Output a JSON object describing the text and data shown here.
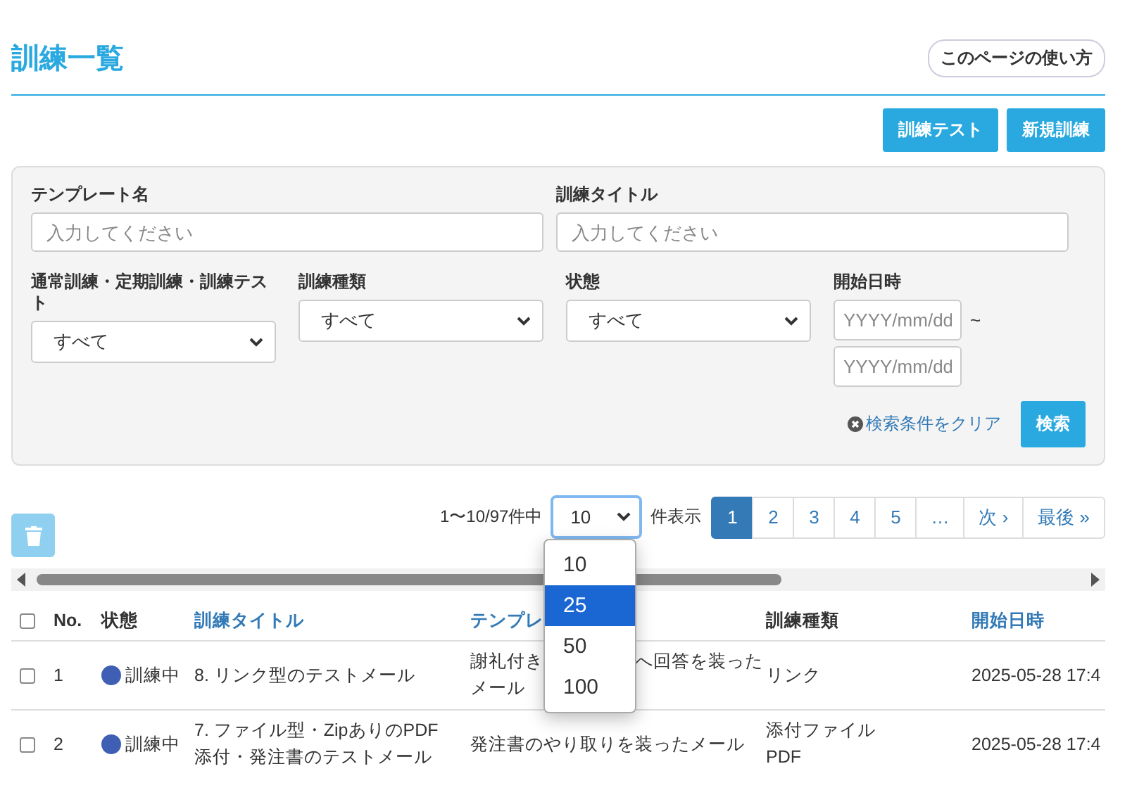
{
  "page": {
    "title": "訓練一覧",
    "help_button": "このページの使い方"
  },
  "actions": [
    "訓練テスト",
    "新規訓練"
  ],
  "filters": {
    "text_fields": [
      {
        "kind": "text",
        "label": "テンプレート名",
        "placeholder": "入力してください"
      },
      {
        "kind": "text",
        "label": "訓練タイトル",
        "placeholder": "入力してください"
      }
    ],
    "option_fields": [
      {
        "kind": "select",
        "label": "通常訓練・定期訓練・訓練テスト",
        "value": "すべて"
      },
      {
        "kind": "select",
        "label": "訓練種類",
        "value": "すべて"
      },
      {
        "kind": "select",
        "label": "状態",
        "value": "すべて"
      },
      {
        "kind": "daterange",
        "label": "開始日時",
        "from_placeholder": "YYYY/mm/dd",
        "to_placeholder": "YYYY/mm/dd",
        "separator": "~"
      }
    ],
    "clear_link": "検索条件をクリア",
    "search_button": "検索"
  },
  "pagination": {
    "range_text": "1〜10/97件中",
    "page_size": "10",
    "page_size_suffix": "件表示",
    "page_size_options": [
      {
        "label": "10",
        "selected": false
      },
      {
        "label": "25",
        "selected": true
      },
      {
        "label": "50",
        "selected": false
      },
      {
        "label": "100",
        "selected": false
      }
    ],
    "pages": [
      {
        "label": "1",
        "selected": true
      },
      {
        "label": "2",
        "selected": false
      },
      {
        "label": "3",
        "selected": false
      },
      {
        "label": "4",
        "selected": false
      },
      {
        "label": "5",
        "selected": false
      },
      {
        "label": "…",
        "selected": false
      },
      {
        "label": "次 ›",
        "selected": false
      },
      {
        "label": "最後 »",
        "selected": false
      }
    ]
  },
  "table": {
    "select_all_checked": false,
    "columns": [
      {
        "label": "No.",
        "link": false
      },
      {
        "label": "状態",
        "link": false
      },
      {
        "label": "訓練タイトル",
        "link": true
      },
      {
        "label": "テンプレ",
        "link": true
      },
      {
        "label": "訓練種類",
        "link": false
      },
      {
        "label": "開始日時",
        "link": true
      }
    ],
    "rows": [
      {
        "checked": false,
        "no": "1",
        "status": "訓練中",
        "color": "#3f5fb5",
        "title": "8. リンク型のテストメール",
        "template": [
          [
            "謝礼付き",
            "へ回答を装った"
          ],
          [
            "メール"
          ]
        ],
        "type": [
          "リンク"
        ],
        "start": "2025-05-28 17:4"
      },
      {
        "checked": false,
        "no": "2",
        "status": "訓練中",
        "color": "#3f5fb5",
        "title": "7. ファイル型・ZipありのPDF添付・発注書のテストメール",
        "template": [
          [
            "発注書のやり取りを装ったメール"
          ]
        ],
        "type": [
          "添付ファイル",
          "PDF"
        ],
        "start": "2025-05-28 17:4"
      }
    ]
  }
}
